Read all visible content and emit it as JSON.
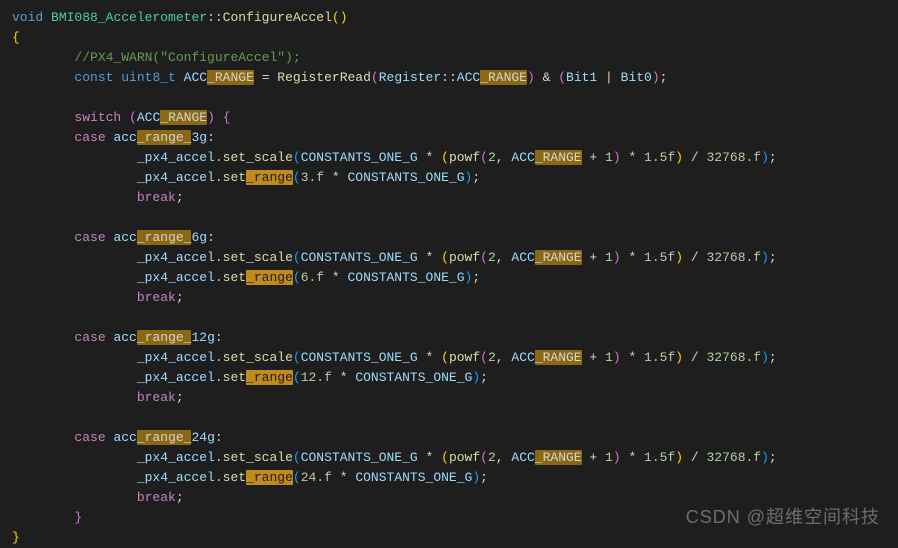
{
  "code": {
    "l1": {
      "kw1": "void",
      "cls": "BMI088_Accelerometer",
      "op": "::",
      "fn": "ConfigureAccel",
      "p": "()"
    },
    "l2": "{",
    "l3": {
      "indent": "        ",
      "text": "//PX4_WARN(\"ConfigureAccel\");"
    },
    "l4": {
      "indent": "        ",
      "kw1": "const",
      "type": "uint8_t",
      "var": "ACC",
      "hl": "_RANGE",
      "eq": " = ",
      "fn": "RegisterRead",
      "po": "(",
      "ns": "Register",
      "dc": "::",
      "enum": "ACC",
      "hl2": "_RANGE",
      "pc": ")",
      "and": " & ",
      "po2": "(",
      "b1": "Bit1",
      "or": " | ",
      "b0": "Bit0",
      "pc2": ")",
      "semi": ";"
    },
    "l5": "",
    "l6": {
      "indent": "        ",
      "kw": "switch",
      "sp": " ",
      "po": "(",
      "var": "ACC",
      "hl": "_RANGE",
      "pc": ")",
      "sp2": " ",
      "brace": "{"
    },
    "l7": {
      "indent": "        ",
      "kw": "case",
      "sp": " ",
      "v1": "acc",
      "hl": "_range_",
      "v2": "3g",
      "colon": ":"
    },
    "l8": {
      "indent": "                ",
      "obj": "_px4_accel",
      "dot": ".",
      "fn": "set_scale",
      "po": "(",
      "c1": "CONSTANTS_ONE_G",
      "mul": " * ",
      "po2": "(",
      "fn2": "powf",
      "po3": "(",
      "n1": "2",
      "comma": ", ",
      "v1": "ACC",
      "hl": "_RANGE",
      "plus": " + ",
      "n2": "1",
      "pc3": ")",
      "mul2": " * ",
      "n3": "1.5f",
      "pc2": ")",
      "div": " / ",
      "n4": "32768.f",
      "pc": ")",
      "semi": ";"
    },
    "l9": {
      "indent": "                ",
      "obj": "_px4_accel",
      "dot": ".",
      "fn1": "set",
      "hl": "_range",
      "po": "(",
      "n1": "3.f",
      "mul": " * ",
      "c1": "CONSTANTS_ONE_G",
      "pc": ")",
      "semi": ";"
    },
    "l10": {
      "indent": "                ",
      "kw": "break",
      "semi": ";"
    },
    "l11": "",
    "l12": {
      "indent": "        ",
      "kw": "case",
      "sp": " ",
      "v1": "acc",
      "hl": "_range_",
      "v2": "6g",
      "colon": ":"
    },
    "l13": {
      "indent": "                ",
      "obj": "_px4_accel",
      "dot": ".",
      "fn": "set_scale",
      "po": "(",
      "c1": "CONSTANTS_ONE_G",
      "mul": " * ",
      "po2": "(",
      "fn2": "powf",
      "po3": "(",
      "n1": "2",
      "comma": ", ",
      "v1": "ACC",
      "hl": "_RANGE",
      "plus": " + ",
      "n2": "1",
      "pc3": ")",
      "mul2": " * ",
      "n3": "1.5f",
      "pc2": ")",
      "div": " / ",
      "n4": "32768.f",
      "pc": ")",
      "semi": ";"
    },
    "l14": {
      "indent": "                ",
      "obj": "_px4_accel",
      "dot": ".",
      "fn1": "set",
      "hl": "_range",
      "po": "(",
      "n1": "6.f",
      "mul": " * ",
      "c1": "CONSTANTS_ONE_G",
      "pc": ")",
      "semi": ";"
    },
    "l15": {
      "indent": "                ",
      "kw": "break",
      "semi": ";"
    },
    "l16": "",
    "l17": {
      "indent": "        ",
      "kw": "case",
      "sp": " ",
      "v1": "acc",
      "hl": "_range_",
      "v2": "12g",
      "colon": ":"
    },
    "l18": {
      "indent": "                ",
      "obj": "_px4_accel",
      "dot": ".",
      "fn": "set_scale",
      "po": "(",
      "c1": "CONSTANTS_ONE_G",
      "mul": " * ",
      "po2": "(",
      "fn2": "powf",
      "po3": "(",
      "n1": "2",
      "comma": ", ",
      "v1": "ACC",
      "hl": "_RANGE",
      "plus": " + ",
      "n2": "1",
      "pc3": ")",
      "mul2": " * ",
      "n3": "1.5f",
      "pc2": ")",
      "div": " / ",
      "n4": "32768.f",
      "pc": ")",
      "semi": ";"
    },
    "l19": {
      "indent": "                ",
      "obj": "_px4_accel",
      "dot": ".",
      "fn1": "set",
      "hl": "_range",
      "po": "(",
      "n1": "12.f",
      "mul": " * ",
      "c1": "CONSTANTS_ONE_G",
      "pc": ")",
      "semi": ";"
    },
    "l20": {
      "indent": "                ",
      "kw": "break",
      "semi": ";"
    },
    "l21": "",
    "l22": {
      "indent": "        ",
      "kw": "case",
      "sp": " ",
      "v1": "acc",
      "hl": "_range_",
      "v2": "24g",
      "colon": ":"
    },
    "l23": {
      "indent": "                ",
      "obj": "_px4_accel",
      "dot": ".",
      "fn": "set_scale",
      "po": "(",
      "c1": "CONSTANTS_ONE_G",
      "mul": " * ",
      "po2": "(",
      "fn2": "powf",
      "po3": "(",
      "n1": "2",
      "comma": ", ",
      "v1": "ACC",
      "hl": "_RANGE",
      "plus": " + ",
      "n2": "1",
      "pc3": ")",
      "mul2": " * ",
      "n3": "1.5f",
      "pc2": ")",
      "div": " / ",
      "n4": "32768.f",
      "pc": ")",
      "semi": ";"
    },
    "l24": {
      "indent": "                ",
      "obj": "_px4_accel",
      "dot": ".",
      "fn1": "set",
      "hl": "_range",
      "po": "(",
      "n1": "24.f",
      "mul": " * ",
      "c1": "CONSTANTS_ONE_G",
      "pc": ")",
      "semi": ";"
    },
    "l25": {
      "indent": "                ",
      "kw": "break",
      "semi": ";"
    },
    "l26": {
      "indent": "        ",
      "brace": "}"
    },
    "l27": "}"
  },
  "watermark": "CSDN @超维空间科技"
}
